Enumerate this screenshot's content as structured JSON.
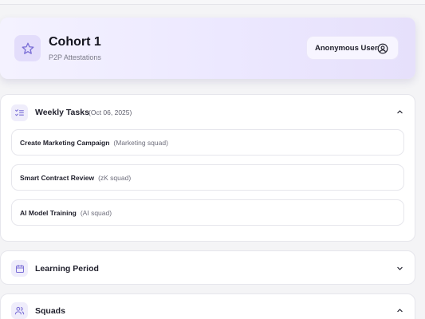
{
  "header": {
    "title": "Cohort 1",
    "subtitle": "P2P Attestations",
    "icon": "star-icon",
    "user_label": "Anonymous User",
    "user_icon": "user-circle-icon"
  },
  "sections": {
    "weekly": {
      "title": "Weekly Tasks",
      "date": "(Oct 06, 2025)",
      "icon": "list-checks-icon",
      "expanded": true,
      "tasks": [
        {
          "name": "Create Marketing Campaign",
          "squad": "(Marketing squad)"
        },
        {
          "name": "Smart Contract Review",
          "squad": "(zK squad)"
        },
        {
          "name": "AI Model Training",
          "squad": "(AI squad)"
        }
      ]
    },
    "learning": {
      "title": "Learning Period",
      "icon": "calendar-icon",
      "expanded": false
    },
    "squads": {
      "title": "Squads",
      "icon": "users-icon",
      "expanded": true
    }
  },
  "colors": {
    "accent": "#7b6fd6",
    "header_bg": "#ece8ff",
    "card_border": "#e6e6ec"
  }
}
